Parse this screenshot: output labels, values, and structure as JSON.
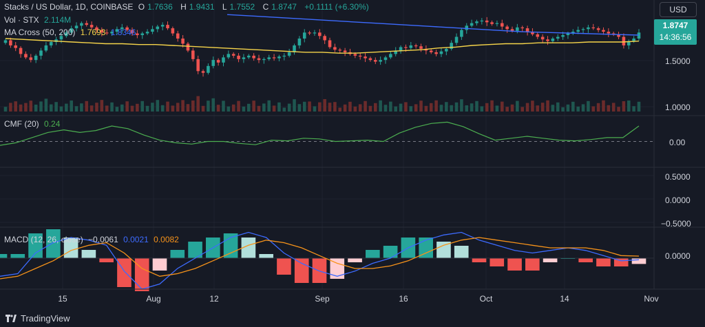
{
  "header": {
    "title": "Stacks / US Dollar, 1D, COINBASE",
    "ohlc": [
      {
        "k": "O",
        "v": "1.7636"
      },
      {
        "k": "H",
        "v": "1.9431"
      },
      {
        "k": "L",
        "v": "1.7552"
      },
      {
        "k": "C",
        "v": "1.8747"
      }
    ],
    "change": "+0.1111 (+6.30%)"
  },
  "vol": {
    "label": "Vol · STX",
    "value": "2.114M"
  },
  "ma": {
    "label": "MA Cross (50, 200)",
    "v1": "1.7693",
    "v2": "1.8346"
  },
  "cmf": {
    "label": "CMF (20)",
    "value": "0.24"
  },
  "macd": {
    "label": "MACD (12, 26, close)",
    "v1": "−0.0061",
    "v2": "0.0021",
    "v3": "0.0082"
  },
  "currency": "USD",
  "last_price": {
    "value": "1.8747",
    "countdown": "14:36:56"
  },
  "price_axis": [
    "1.5000",
    "1.0000"
  ],
  "cmf_axis": [
    "0.00"
  ],
  "macd_scale_axis": [
    "0.5000",
    "0.0000",
    "−0.5000"
  ],
  "macd_axis": [
    "0.0000"
  ],
  "time_axis": [
    "15",
    "Aug",
    "12",
    "Sep",
    "16",
    "Oct",
    "14",
    "Nov"
  ],
  "footer": {
    "brand": "TradingView"
  },
  "colors": {
    "up": "#26a69a",
    "down": "#ef5350",
    "ma50": "#f7d54a",
    "ma200": "#3d6bff",
    "cmf": "#4caf50",
    "macd": "#3d6bff",
    "signal": "#f7931a"
  },
  "chart_data": {
    "type": "line",
    "title": "Stacks / US Dollar, 1D, COINBASE",
    "candles_close": [
      1.78,
      1.72,
      1.69,
      1.62,
      1.58,
      1.55,
      1.6,
      1.66,
      1.72,
      1.76,
      1.79,
      1.83,
      1.87,
      1.92,
      1.95,
      1.98,
      1.96,
      1.93,
      1.9,
      1.87,
      1.86,
      1.88,
      1.91,
      1.93,
      1.9,
      1.86,
      1.84,
      1.86,
      1.88,
      1.91,
      1.94,
      1.96,
      1.92,
      1.86,
      1.8,
      1.74,
      1.66,
      1.56,
      1.42,
      1.4,
      1.48,
      1.55,
      1.52,
      1.58,
      1.62,
      1.6,
      1.56,
      1.58,
      1.6,
      1.57,
      1.55,
      1.56,
      1.58,
      1.57,
      1.59,
      1.6,
      1.64,
      1.72,
      1.8,
      1.87,
      1.86,
      1.87,
      1.83,
      1.78,
      1.7,
      1.67,
      1.66,
      1.64,
      1.62,
      1.6,
      1.59,
      1.57,
      1.55,
      1.53,
      1.55,
      1.58,
      1.62,
      1.66,
      1.7,
      1.69,
      1.72,
      1.71,
      1.68,
      1.66,
      1.64,
      1.62,
      1.65,
      1.68,
      1.75,
      1.82,
      1.9,
      1.95,
      1.98,
      2.0,
      2.01,
      1.99,
      1.97,
      1.98,
      1.94,
      1.91,
      1.89,
      1.93,
      1.92,
      1.88,
      1.85,
      1.82,
      1.79,
      1.77,
      1.8,
      1.82,
      1.84,
      1.86,
      1.88,
      1.9,
      1.91,
      1.93,
      1.92,
      1.9,
      1.88,
      1.86,
      1.85,
      1.82,
      1.72,
      1.77,
      1.8,
      1.87
    ],
    "ma50": [
      1.8,
      1.79,
      1.78,
      1.77,
      1.76,
      1.75,
      1.74,
      1.74,
      1.73,
      1.73,
      1.72,
      1.71,
      1.7,
      1.69,
      1.68,
      1.67,
      1.66,
      1.65,
      1.64,
      1.64,
      1.63,
      1.63,
      1.64,
      1.65,
      1.66,
      1.67,
      1.69,
      1.7,
      1.72,
      1.73,
      1.74,
      1.74,
      1.75,
      1.75,
      1.75,
      1.76,
      1.76,
      1.76,
      1.77
    ],
    "ma200": [
      2.08,
      2.06,
      2.04,
      2.02,
      2.0,
      1.98,
      1.96,
      1.94,
      1.92,
      1.9,
      1.88,
      1.87,
      1.86,
      1.85,
      1.84
    ],
    "cmf": [
      -0.06,
      -0.02,
      0.06,
      0.14,
      0.18,
      0.14,
      0.17,
      0.24,
      0.2,
      0.1,
      0.02,
      -0.02,
      -0.04,
      0.0,
      0.0,
      -0.03,
      -0.05,
      0.02,
      0.01,
      0.05,
      0.04,
      0.0,
      0.01,
      0.02,
      0.0,
      0.13,
      0.22,
      0.28,
      0.3,
      0.23,
      0.12,
      0.02,
      0.05,
      0.08,
      0.05,
      0.02,
      0.01,
      0.03,
      0.06,
      0.06,
      0.24
    ],
    "macd": [
      -0.07,
      -0.06,
      0.02,
      0.06,
      0.08,
      0.07,
      0.05,
      -0.05,
      -0.12,
      -0.1,
      -0.04,
      0.0,
      0.04,
      0.08,
      0.1,
      0.08,
      0.02,
      -0.02,
      -0.05,
      -0.07,
      -0.05,
      -0.02,
      0.0,
      0.04,
      0.07,
      0.09,
      0.1,
      0.07,
      0.05,
      0.03,
      0.02,
      0.03,
      0.04,
      0.03,
      0.01,
      -0.01,
      -0.006
    ],
    "signal": [
      -0.08,
      -0.07,
      -0.04,
      -0.01,
      0.03,
      0.05,
      0.06,
      0.02,
      -0.04,
      -0.07,
      -0.06,
      -0.04,
      -0.01,
      0.02,
      0.05,
      0.07,
      0.06,
      0.04,
      0.01,
      -0.02,
      -0.04,
      -0.04,
      -0.03,
      -0.01,
      0.02,
      0.05,
      0.07,
      0.08,
      0.07,
      0.06,
      0.05,
      0.04,
      0.04,
      0.04,
      0.03,
      0.01,
      0.008
    ],
    "ylim_price": [
      0.9,
      2.25
    ],
    "ylim_cmf": [
      -0.4,
      0.4
    ],
    "ylim_macd": [
      -0.12,
      0.12
    ]
  }
}
